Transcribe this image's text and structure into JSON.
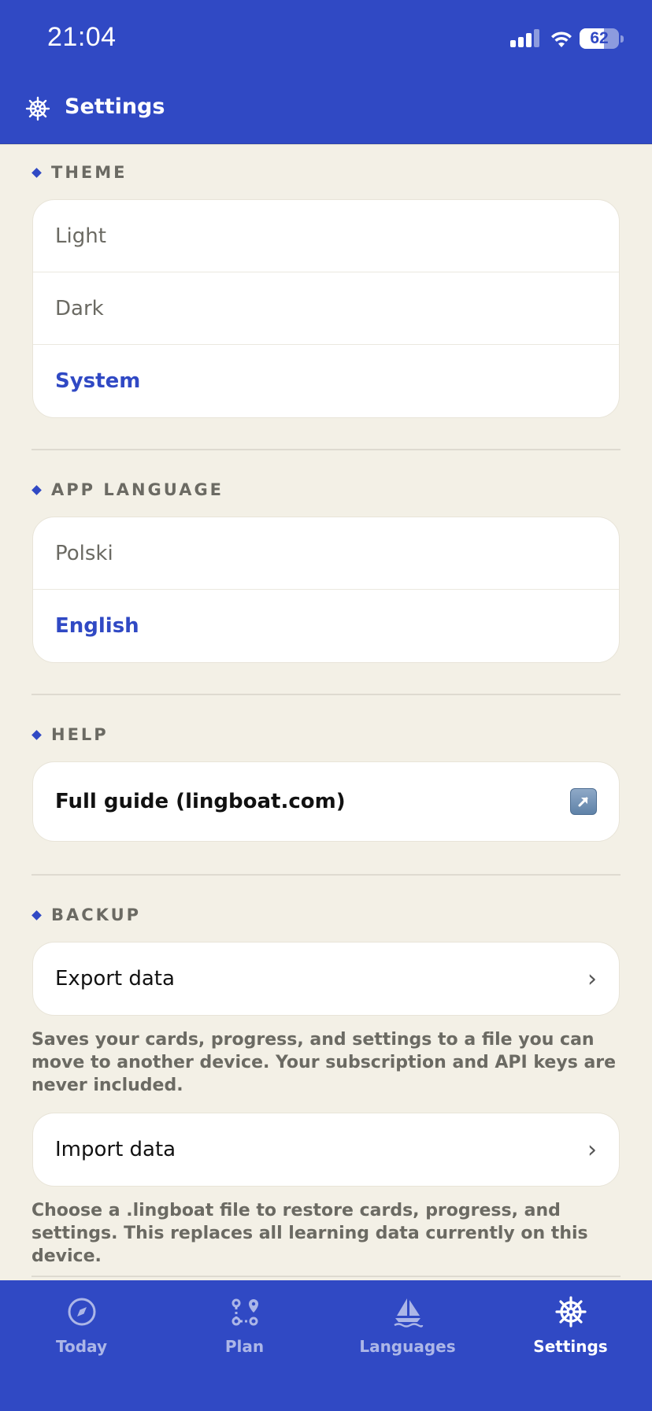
{
  "status_bar": {
    "time": "21:04",
    "battery": "62",
    "battery_level": 0.62
  },
  "header": {
    "title": "Settings",
    "icon": "ship-wheel-icon"
  },
  "sections": {
    "theme": {
      "label": "THEME",
      "options": [
        "Light",
        "Dark",
        "System"
      ],
      "selected": "System"
    },
    "app_language": {
      "label": "APP LANGUAGE",
      "options": [
        "Polski",
        "English"
      ],
      "selected": "English"
    },
    "help": {
      "label": "HELP",
      "guide_label": "Full guide (lingboat.com)",
      "guide_icon": "external-link-icon"
    },
    "backup": {
      "label": "BACKUP",
      "export_label": "Export data",
      "export_note": "Saves your cards, progress, and settings to a file you can move to another device. Your subscription and API keys are never included.",
      "import_label": "Import data",
      "import_note": "Choose a .lingboat file to restore cards, progress, and settings. This replaces all learning data currently on this device.",
      "chevron": "›"
    }
  },
  "tabbar": {
    "tabs": [
      {
        "label": "Today",
        "icon": "compass-icon"
      },
      {
        "label": "Plan",
        "icon": "route-icon"
      },
      {
        "label": "Languages",
        "icon": "sailboat-icon"
      },
      {
        "label": "Settings",
        "icon": "ship-wheel-icon"
      }
    ],
    "active": "Settings"
  },
  "colors": {
    "accent": "#3049c4",
    "background": "#f3f0e6",
    "muted_text": "#6b6a63"
  }
}
